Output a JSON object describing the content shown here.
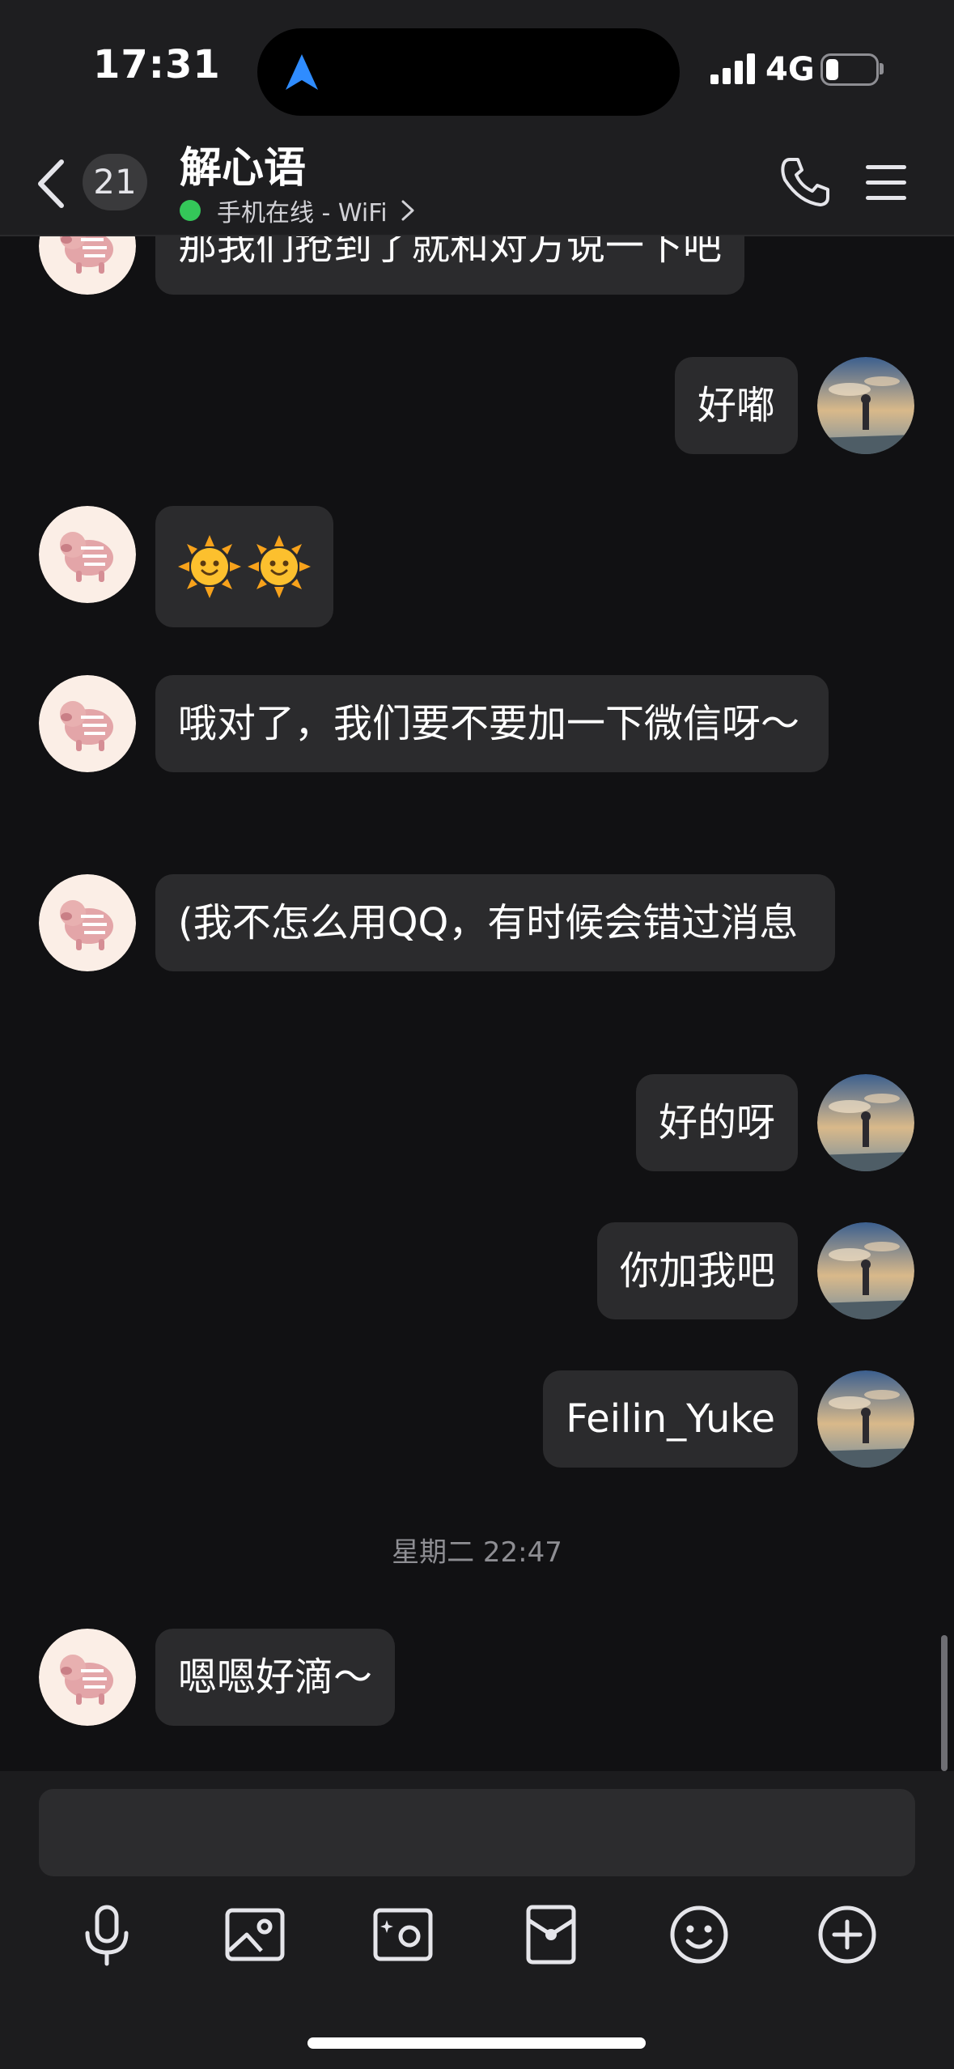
{
  "status_bar": {
    "time": "17:31",
    "network": "4G"
  },
  "header": {
    "unread_count": "21",
    "contact_name": "解心语",
    "presence": "手机在线 - WiFi"
  },
  "messages": [
    {
      "side": "left",
      "text": "那我们抢到了就和对方说一下吧"
    },
    {
      "side": "right",
      "text": "好嘟"
    },
    {
      "side": "left",
      "emoji": [
        "sun-smile",
        "sun-smile"
      ]
    },
    {
      "side": "left",
      "text": "哦对了，我们要不要加一下微信呀～"
    },
    {
      "side": "left",
      "text": "(我不怎么用QQ，有时候会错过消息"
    },
    {
      "side": "right",
      "text": "好的呀"
    },
    {
      "side": "right",
      "text": "你加我吧"
    },
    {
      "side": "right",
      "text": "Feilin_Yuke"
    },
    {
      "timestamp": "星期二 22:47"
    },
    {
      "side": "left",
      "text": "嗯嗯好滴～"
    }
  ],
  "composer": {
    "value": ""
  },
  "toolbar": {
    "icons": [
      "microphone-icon",
      "image-icon",
      "camera-icon",
      "red-packet-icon",
      "emoji-icon",
      "plus-icon"
    ]
  },
  "colors": {
    "background": "#111113",
    "bubble": "#2b2b2d",
    "header": "#1e1e20",
    "online": "#34c759",
    "accent": "#2f8cff"
  }
}
